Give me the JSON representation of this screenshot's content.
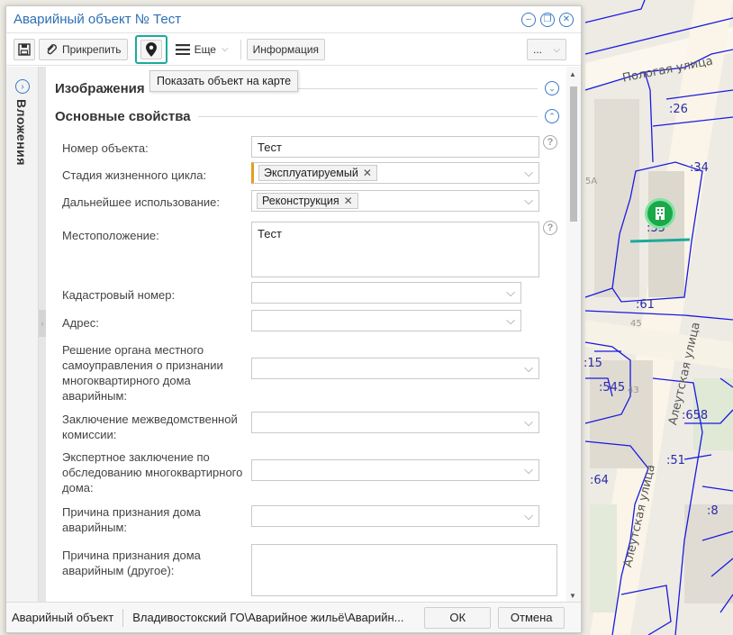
{
  "window": {
    "title": "Аварийный объект № Тест"
  },
  "toolbar": {
    "attach_label": "Прикрепить",
    "more_label": "Еще",
    "info_label": "Информация",
    "extra_label": "..."
  },
  "tooltip": {
    "text": "Показать объект на карте"
  },
  "sidebar": {
    "label": "Вложения"
  },
  "sections": {
    "images": "Изображения",
    "main": "Основные свойства"
  },
  "fields": {
    "object_number": {
      "label": "Номер объекта:",
      "value": "Тест"
    },
    "lifecycle": {
      "label": "Стадия жизненного цикла:",
      "tag": "Эксплуатируемый"
    },
    "further_use": {
      "label": "Дальнейшее использование:",
      "tag": "Реконструкция"
    },
    "location": {
      "label": "Местоположение:",
      "value": "Тест"
    },
    "cadastral": {
      "label": "Кадастровый номер:",
      "value": ""
    },
    "address": {
      "label": "Адрес:",
      "value": ""
    },
    "decision": {
      "label": "Решение органа местного самоуправления о признании многоквартирного дома аварийным:",
      "value": ""
    },
    "commission": {
      "label": "Заключение межведомственной комиссии:",
      "value": ""
    },
    "expert": {
      "label": "Экспертное заключение по обследованию многоквартирного дома:",
      "value": ""
    },
    "reason": {
      "label": "Причина признания дома аварийным:",
      "value": ""
    },
    "reason_other": {
      "label": "Причина признания дома аварийным (другое):",
      "value": ""
    }
  },
  "footer": {
    "type": "Аварийный объект",
    "path": "Владивостокский ГО\\Аварийное жильё\\Аварийн...",
    "ok_label": "ОК",
    "cancel_label": "Отмена"
  },
  "map": {
    "streets": [
      "Пологая улица",
      "Алеутская улица",
      "Алеутская улица"
    ],
    "parcels": [
      ":26",
      ":34",
      ":35",
      ":61",
      ":15",
      ":545",
      ":658",
      ":51",
      ":64",
      ":8"
    ],
    "building_numbers": [
      "5A",
      "43",
      "45"
    ],
    "accent": "#1aa84a"
  }
}
